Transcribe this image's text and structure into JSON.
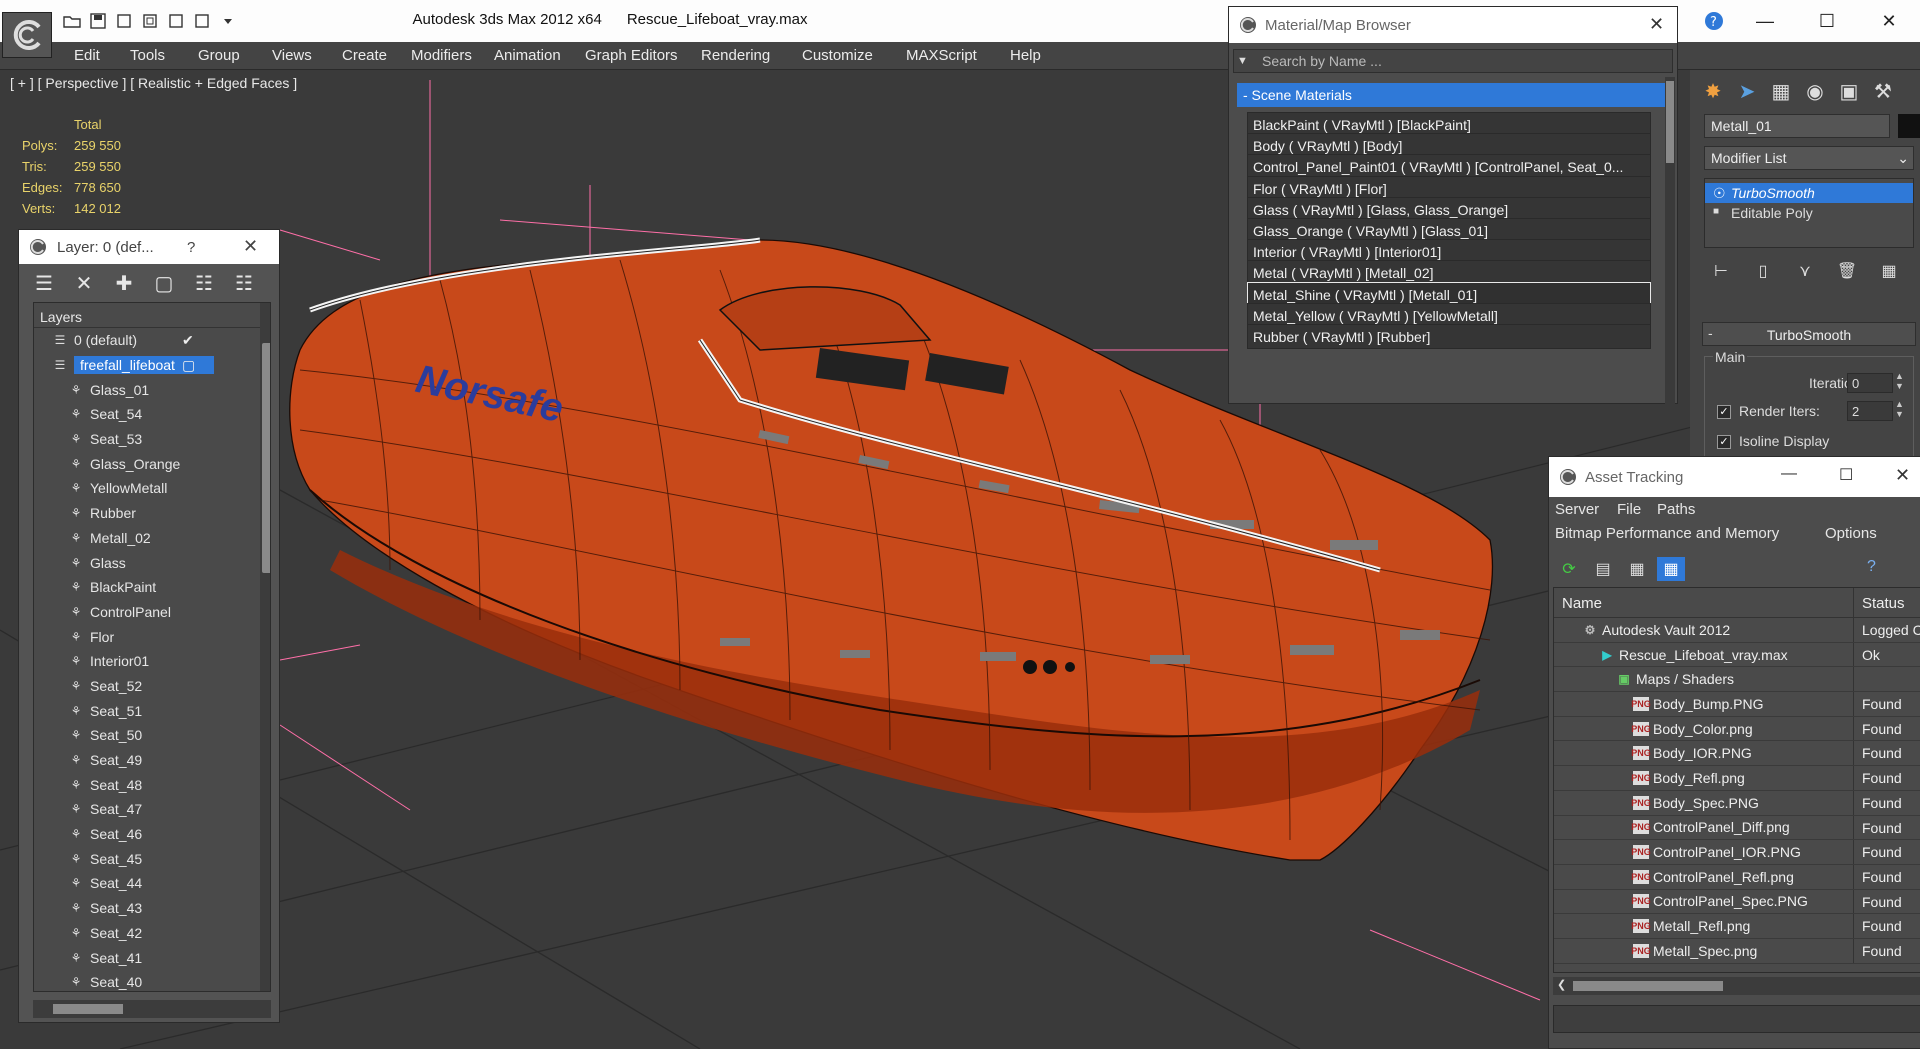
{
  "window": {
    "app_title": "Autodesk 3ds Max  2012 x64",
    "file_name": "Rescue_Lifeboat_vray.max"
  },
  "menu": [
    "Edit",
    "Tools",
    "Group",
    "Views",
    "Create",
    "Modifiers",
    "Animation",
    "Graph Editors",
    "Rendering",
    "Customize",
    "MAXScript",
    "Help"
  ],
  "viewport": {
    "label": "[ + ] [ Perspective ] [ Realistic + Edged Faces ]",
    "stats_header": "Total",
    "stats": [
      {
        "label": "Polys:",
        "value": "259 550"
      },
      {
        "label": "Tris:",
        "value": "259 550"
      },
      {
        "label": "Edges:",
        "value": "778 650"
      },
      {
        "label": "Verts:",
        "value": "142 012"
      }
    ],
    "boat_text": "Norsafe"
  },
  "layer_panel": {
    "title": "Layer: 0 (def...",
    "help": "?",
    "tree_header": "Layers",
    "layers": [
      {
        "name": "0 (default)",
        "level": 0,
        "checked": true
      },
      {
        "name": "freefall_lifeboat",
        "level": 0,
        "selected": true
      },
      {
        "name": "Glass_01",
        "level": 1
      },
      {
        "name": "Seat_54",
        "level": 1
      },
      {
        "name": "Seat_53",
        "level": 1
      },
      {
        "name": "Glass_Orange",
        "level": 1
      },
      {
        "name": "YellowMetall",
        "level": 1
      },
      {
        "name": "Rubber",
        "level": 1
      },
      {
        "name": "Metall_02",
        "level": 1
      },
      {
        "name": "Glass",
        "level": 1
      },
      {
        "name": "BlackPaint",
        "level": 1
      },
      {
        "name": "ControlPanel",
        "level": 1
      },
      {
        "name": "Flor",
        "level": 1
      },
      {
        "name": "Interior01",
        "level": 1
      },
      {
        "name": "Seat_52",
        "level": 1
      },
      {
        "name": "Seat_51",
        "level": 1
      },
      {
        "name": "Seat_50",
        "level": 1
      },
      {
        "name": "Seat_49",
        "level": 1
      },
      {
        "name": "Seat_48",
        "level": 1
      },
      {
        "name": "Seat_47",
        "level": 1
      },
      {
        "name": "Seat_46",
        "level": 1
      },
      {
        "name": "Seat_45",
        "level": 1
      },
      {
        "name": "Seat_44",
        "level": 1
      },
      {
        "name": "Seat_43",
        "level": 1
      },
      {
        "name": "Seat_42",
        "level": 1
      },
      {
        "name": "Seat_41",
        "level": 1
      },
      {
        "name": "Seat_40",
        "level": 1
      }
    ]
  },
  "material_browser": {
    "title": "Material/Map Browser",
    "search_placeholder": "Search by Name ...",
    "group": "- Scene Materials",
    "materials": [
      "BlackPaint  ( VRayMtl ) [BlackPaint]",
      "Body  ( VRayMtl ) [Body]",
      "Control_Panel_Paint01  ( VRayMtl ) [ControlPanel, Seat_0...",
      "Flor  ( VRayMtl ) [Flor]",
      "Glass  ( VRayMtl ) [Glass, Glass_Orange]",
      "Glass_Orange  ( VRayMtl ) [Glass_01]",
      "Interior  ( VRayMtl ) [Interior01]",
      "Metal  ( VRayMtl ) [Metall_02]",
      "Metal_Shine  ( VRayMtl ) [Metall_01]",
      "Metal_Yellow  ( VRayMtl ) [YellowMetall]",
      "Rubber  ( VRayMtl ) [Rubber]"
    ],
    "highlighted_index": 8
  },
  "command_panel": {
    "object_name": "Metall_01",
    "modifier_list": "Modifier List",
    "stack": [
      {
        "name": "TurboSmooth",
        "selected": true
      },
      {
        "name": "Editable Poly",
        "selected": false
      }
    ],
    "rollout_title": "TurboSmooth",
    "group_main": "Main",
    "iterations_label": "Iterations:",
    "iterations_value": "0",
    "render_iters_label": "Render Iters:",
    "render_iters_value": "2",
    "isoline_label": "Isoline Display"
  },
  "asset_tracking": {
    "title": "Asset Tracking",
    "menu1": [
      "Server",
      "File",
      "Paths"
    ],
    "menu2": [
      "Bitmap Performance and Memory",
      "Options"
    ],
    "col_name": "Name",
    "col_status": "Status",
    "rows": [
      {
        "name": "Autodesk Vault 2012",
        "status": "Logged C",
        "level": 0,
        "icon": "vault"
      },
      {
        "name": "Rescue_Lifeboat_vray.max",
        "status": "Ok",
        "level": 1,
        "icon": "max"
      },
      {
        "name": "Maps / Shaders",
        "status": "",
        "level": 2,
        "icon": "maps"
      },
      {
        "name": "Body_Bump.PNG",
        "status": "Found",
        "level": 3,
        "icon": "png"
      },
      {
        "name": "Body_Color.png",
        "status": "Found",
        "level": 3,
        "icon": "png"
      },
      {
        "name": "Body_IOR.PNG",
        "status": "Found",
        "level": 3,
        "icon": "png"
      },
      {
        "name": "Body_Refl.png",
        "status": "Found",
        "level": 3,
        "icon": "png"
      },
      {
        "name": "Body_Spec.PNG",
        "status": "Found",
        "level": 3,
        "icon": "png"
      },
      {
        "name": "ControlPanel_Diff.png",
        "status": "Found",
        "level": 3,
        "icon": "png"
      },
      {
        "name": "ControlPanel_IOR.PNG",
        "status": "Found",
        "level": 3,
        "icon": "png"
      },
      {
        "name": "ControlPanel_Refl.png",
        "status": "Found",
        "level": 3,
        "icon": "png"
      },
      {
        "name": "ControlPanel_Spec.PNG",
        "status": "Found",
        "level": 3,
        "icon": "png"
      },
      {
        "name": "Metall_Refl.png",
        "status": "Found",
        "level": 3,
        "icon": "png"
      },
      {
        "name": "Metall_Spec.png",
        "status": "Found",
        "level": 3,
        "icon": "png"
      }
    ]
  },
  "colors": {
    "selection": "#2f79d8",
    "boat_orange": "#c8491a",
    "stats_yellow": "#e9d36a"
  }
}
